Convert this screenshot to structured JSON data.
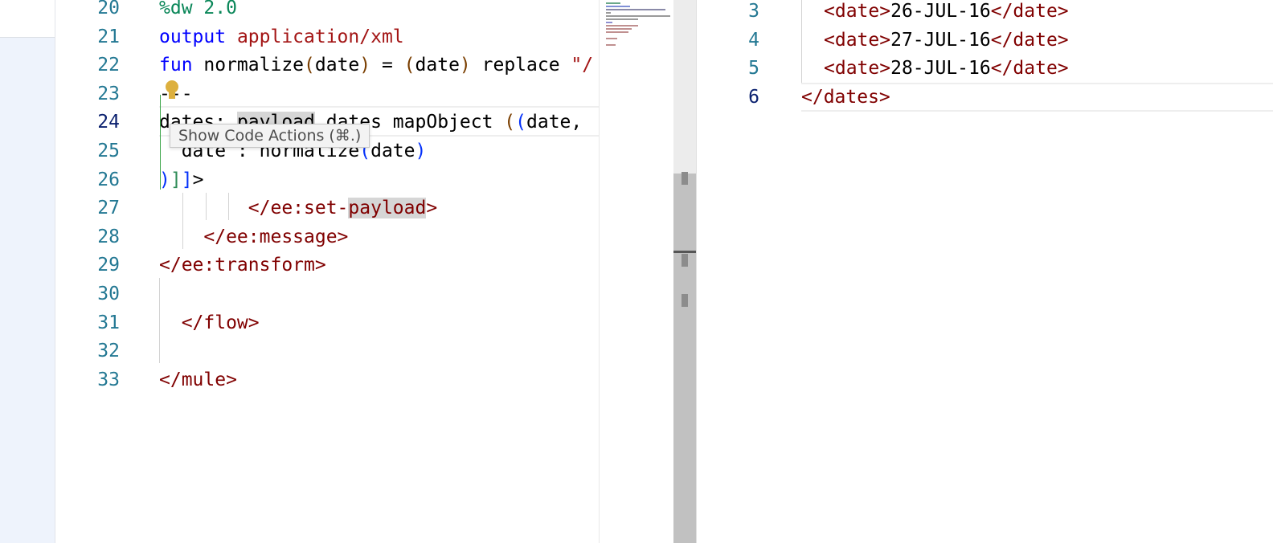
{
  "editor": {
    "lines": [
      {
        "num": "20",
        "segments": [
          {
            "t": "%dw 2.0",
            "c": "green"
          }
        ]
      },
      {
        "num": "21",
        "segments": [
          {
            "t": "output ",
            "c": "blue"
          },
          {
            "t": "application/xml",
            "c": "red"
          }
        ]
      },
      {
        "num": "22",
        "segments": [
          {
            "t": "fun ",
            "c": "blue"
          },
          {
            "t": "normalize",
            "c": "plain"
          },
          {
            "t": "(",
            "c": "brown"
          },
          {
            "t": "date",
            "c": "plain"
          },
          {
            "t": ")",
            "c": "brown"
          },
          {
            "t": " = ",
            "c": "plain"
          },
          {
            "t": "(",
            "c": "brown"
          },
          {
            "t": "date",
            "c": "plain"
          },
          {
            "t": ")",
            "c": "brown"
          },
          {
            "t": " replace ",
            "c": "plain"
          },
          {
            "t": "\"/",
            "c": "red"
          }
        ]
      },
      {
        "num": "23",
        "segments": [
          {
            "t": "---",
            "c": "plain"
          }
        ]
      },
      {
        "num": "24",
        "current": true,
        "segments": [
          {
            "t": "dates: ",
            "c": "plain"
          },
          {
            "t": "payload",
            "c": "plain",
            "hl": true
          },
          {
            "t": ".dates mapObject ",
            "c": "plain"
          },
          {
            "t": "(",
            "c": "brown"
          },
          {
            "t": "(",
            "c": "paren"
          },
          {
            "t": "date,",
            "c": "plain"
          }
        ]
      },
      {
        "num": "25",
        "segments": [
          {
            "t": "  date : normalize",
            "c": "plain"
          },
          {
            "t": "(",
            "c": "paren"
          },
          {
            "t": "date",
            "c": "plain"
          },
          {
            "t": ")",
            "c": "paren"
          }
        ]
      },
      {
        "num": "26",
        "segments": [
          {
            "t": ")",
            "c": "paren"
          },
          {
            "t": "]",
            "c": "teal"
          },
          {
            "t": "]",
            "c": "paren"
          },
          {
            "t": ">",
            "c": "plain"
          }
        ]
      },
      {
        "num": "27",
        "segments": [
          {
            "t": "        </ee:set-",
            "c": "tag"
          },
          {
            "t": "payload",
            "c": "tag",
            "hl": true
          },
          {
            "t": ">",
            "c": "tag"
          }
        ]
      },
      {
        "num": "28",
        "segments": [
          {
            "t": "    </ee:message>",
            "c": "tag"
          }
        ]
      },
      {
        "num": "29",
        "segments": [
          {
            "t": "</ee:transform>",
            "c": "tag"
          }
        ]
      },
      {
        "num": "30",
        "segments": []
      },
      {
        "num": "31",
        "segments": [
          {
            "t": "  </flow>",
            "c": "tag"
          }
        ]
      },
      {
        "num": "32",
        "segments": []
      },
      {
        "num": "33",
        "segments": [
          {
            "t": "</mule>",
            "c": "tag"
          }
        ]
      }
    ],
    "tooltip": "Show Code Actions (⌘.)"
  },
  "output": {
    "lines": [
      {
        "num": "3",
        "open": "<date>",
        "value": "26-JUL-16",
        "close": "</date>"
      },
      {
        "num": "4",
        "open": "<date>",
        "value": "27-JUL-16",
        "close": "</date>"
      },
      {
        "num": "5",
        "open": "<date>",
        "value": "28-JUL-16",
        "close": "</date>"
      },
      {
        "num": "6",
        "current": true,
        "open": "",
        "value": "",
        "close": "</dates>"
      }
    ]
  },
  "colors": {
    "keyword": "#0000ff",
    "string": "#a31515",
    "tag": "#800000",
    "directive": "#098658",
    "lineNumber": "#237893",
    "lightbulb": "#ddb03e"
  },
  "icons": {
    "lightbulb": "lightbulb-icon"
  }
}
